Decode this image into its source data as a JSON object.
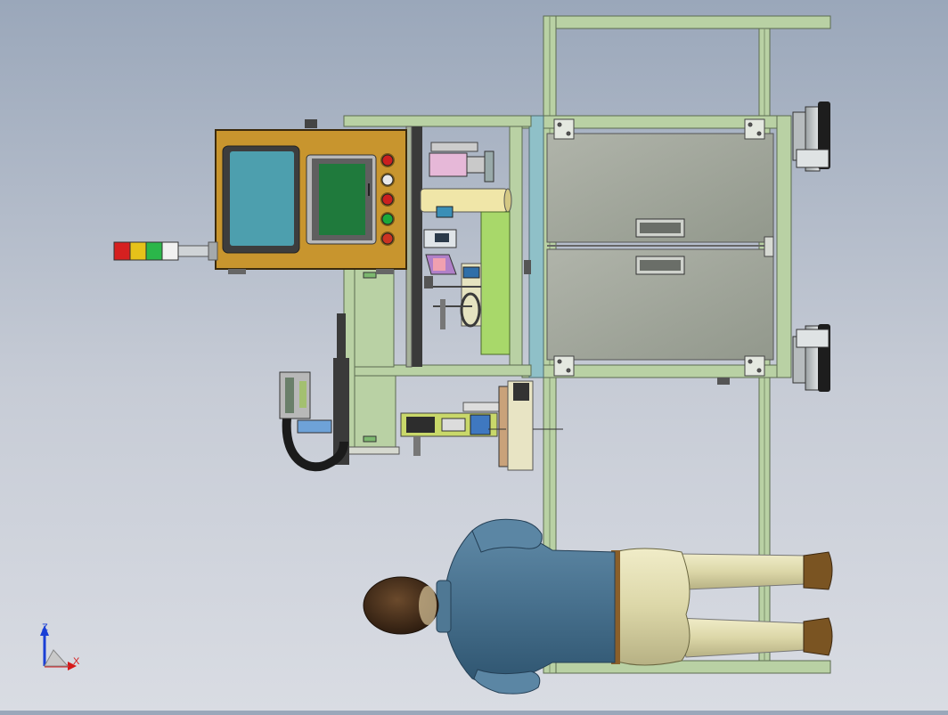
{
  "view": {
    "type": "CAD top view",
    "triad": {
      "z_label": "Z",
      "x_label": "X"
    }
  },
  "colors": {
    "frame": "#b9d1a4",
    "frame_dark": "#7b8f6b",
    "panel_face": "#a2a89c",
    "control_box": "#c8952e",
    "screen_large": "#4d9fae",
    "screen_small": "#1f7a3c",
    "person_jacket": "#47708d",
    "person_pants": "#e0dcb0"
  },
  "control_panel": {
    "button_colors": [
      "#cc1f1f",
      "#e8e8e8",
      "#cc1f1f",
      "#1aa83a",
      "#cc3322"
    ]
  },
  "tower_light": {
    "segment_colors": [
      "#d62020",
      "#e6c21a",
      "#2bb64a",
      "#f1f1f1"
    ]
  }
}
